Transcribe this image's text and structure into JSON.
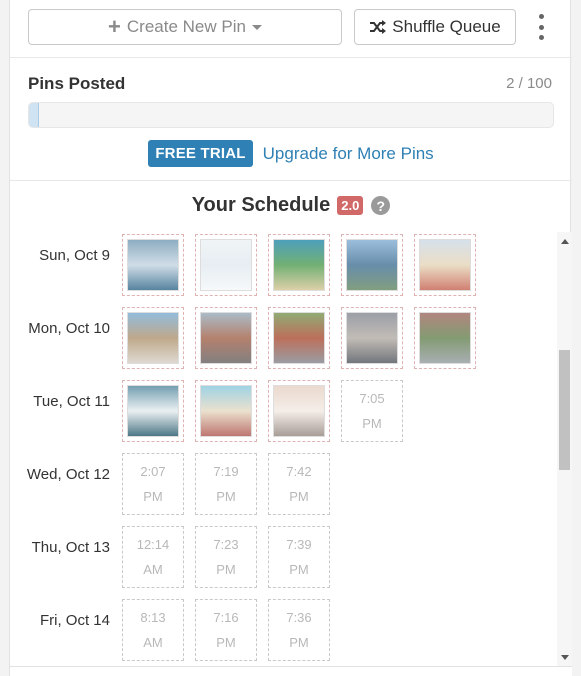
{
  "toolbar": {
    "create_label": "Create New Pin",
    "shuffle_label": "Shuffle Queue"
  },
  "pins_posted": {
    "title": "Pins Posted",
    "count": "2 / 100",
    "progress_fraction": 0.02
  },
  "trial": {
    "badge": "FREE TRIAL",
    "link": "Upgrade for More Pins"
  },
  "schedule": {
    "title": "Your Schedule",
    "version": "2.0",
    "help": "?",
    "days": [
      {
        "label": "Sun, Oct 9",
        "slots": [
          {
            "type": "image",
            "icon": "harbor-boats-photo",
            "colors": [
              "#7a9fb8",
              "#c9d8e3",
              "#3a6f8f"
            ]
          },
          {
            "type": "image",
            "icon": "hazy-sky-photo",
            "colors": [
              "#eef3f6",
              "#e3ebf0",
              "#f6f8fa"
            ]
          },
          {
            "type": "image",
            "icon": "island-aerial-photo",
            "colors": [
              "#2f8fb0",
              "#5aa35c",
              "#d8c89a"
            ]
          },
          {
            "type": "image",
            "icon": "bay-mountains-photo",
            "colors": [
              "#8ab3d6",
              "#4d7a9c",
              "#6c8e6a"
            ]
          },
          {
            "type": "image",
            "icon": "beach-umbrellas-photo",
            "colors": [
              "#cfdbe7",
              "#e8d9bd",
              "#c96a5a"
            ]
          }
        ]
      },
      {
        "label": "Mon, Oct 10",
        "slots": [
          {
            "type": "image",
            "icon": "seaside-town-photo",
            "colors": [
              "#7fb1d6",
              "#b59a78",
              "#d9d3c9"
            ]
          },
          {
            "type": "image",
            "icon": "street-cars-photo",
            "colors": [
              "#9cb0bf",
              "#a86c55",
              "#6d6a6a"
            ]
          },
          {
            "type": "image",
            "icon": "market-crowd-photo",
            "colors": [
              "#7e9d5d",
              "#b1573f",
              "#8a8c94"
            ]
          },
          {
            "type": "image",
            "icon": "crowd-street-photo",
            "colors": [
              "#8a8f98",
              "#b8b1aa",
              "#5a5f66"
            ]
          },
          {
            "type": "image",
            "icon": "brick-street-photo",
            "colors": [
              "#a4716a",
              "#6e8a5a",
              "#9aa1a6"
            ]
          }
        ]
      },
      {
        "label": "Tue, Oct 11",
        "slots": [
          {
            "type": "image",
            "icon": "wave-photo",
            "colors": [
              "#5b8fa4",
              "#e8eef0",
              "#2e6173"
            ]
          },
          {
            "type": "image",
            "icon": "crowded-beach-photo",
            "colors": [
              "#8fcbe0",
              "#e8dcc6",
              "#b35f58"
            ]
          },
          {
            "type": "image",
            "icon": "sunset-pier-photo",
            "colors": [
              "#e8d3c6",
              "#f3ebe5",
              "#9a8d86"
            ]
          },
          {
            "type": "time",
            "time": "7:05",
            "ampm": "PM"
          }
        ]
      },
      {
        "label": "Wed, Oct 12",
        "slots": [
          {
            "type": "time",
            "time": "2:07",
            "ampm": "PM"
          },
          {
            "type": "time",
            "time": "7:19",
            "ampm": "PM"
          },
          {
            "type": "time",
            "time": "7:42",
            "ampm": "PM"
          }
        ]
      },
      {
        "label": "Thu, Oct 13",
        "slots": [
          {
            "type": "time",
            "time": "12:14",
            "ampm": "AM"
          },
          {
            "type": "time",
            "time": "7:23",
            "ampm": "PM"
          },
          {
            "type": "time",
            "time": "7:39",
            "ampm": "PM"
          }
        ]
      },
      {
        "label": "Fri, Oct 14",
        "slots": [
          {
            "type": "time",
            "time": "8:13",
            "ampm": "AM"
          },
          {
            "type": "time",
            "time": "7:16",
            "ampm": "PM"
          },
          {
            "type": "time",
            "time": "7:36",
            "ampm": "PM"
          }
        ]
      }
    ]
  },
  "colors": {
    "accent": "#2f80b4",
    "version_badge": "#c94f4f",
    "progress_fill": "#cfe3f3"
  }
}
